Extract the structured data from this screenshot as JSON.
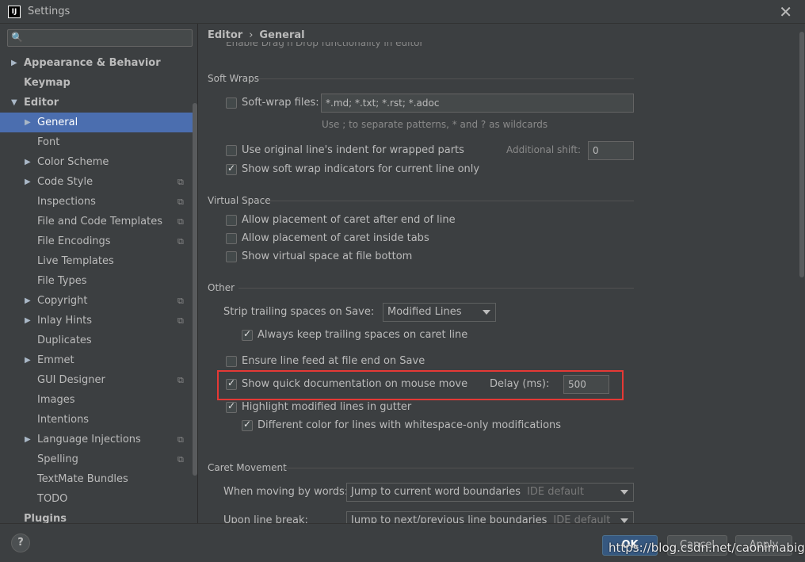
{
  "window": {
    "title": "Settings",
    "app_icon_text": "IJ",
    "close_glyph": "✕"
  },
  "search": {
    "placeholder": "",
    "icon_glyph": "🔍"
  },
  "tree": [
    {
      "label": "Appearance & Behavior",
      "bold": true,
      "arrow": "▶",
      "level": 0
    },
    {
      "label": "Keymap",
      "bold": true,
      "arrow": "",
      "level": 0
    },
    {
      "label": "Editor",
      "bold": true,
      "arrow": "▼",
      "level": 0
    },
    {
      "label": "General",
      "arrow": "▶",
      "level": 1,
      "selected": true
    },
    {
      "label": "Font",
      "arrow": "",
      "level": 1
    },
    {
      "label": "Color Scheme",
      "arrow": "▶",
      "level": 1
    },
    {
      "label": "Code Style",
      "arrow": "▶",
      "level": 1,
      "project": true
    },
    {
      "label": "Inspections",
      "arrow": "",
      "level": 1,
      "project": true
    },
    {
      "label": "File and Code Templates",
      "arrow": "",
      "level": 1,
      "project": true
    },
    {
      "label": "File Encodings",
      "arrow": "",
      "level": 1,
      "project": true
    },
    {
      "label": "Live Templates",
      "arrow": "",
      "level": 1
    },
    {
      "label": "File Types",
      "arrow": "",
      "level": 1
    },
    {
      "label": "Copyright",
      "arrow": "▶",
      "level": 1,
      "project": true
    },
    {
      "label": "Inlay Hints",
      "arrow": "▶",
      "level": 1,
      "project": true
    },
    {
      "label": "Duplicates",
      "arrow": "",
      "level": 1
    },
    {
      "label": "Emmet",
      "arrow": "▶",
      "level": 1
    },
    {
      "label": "GUI Designer",
      "arrow": "",
      "level": 1,
      "project": true
    },
    {
      "label": "Images",
      "arrow": "",
      "level": 1
    },
    {
      "label": "Intentions",
      "arrow": "",
      "level": 1
    },
    {
      "label": "Language Injections",
      "arrow": "▶",
      "level": 1,
      "project": true
    },
    {
      "label": "Spelling",
      "arrow": "",
      "level": 1,
      "project": true
    },
    {
      "label": "TextMate Bundles",
      "arrow": "",
      "level": 1
    },
    {
      "label": "TODO",
      "arrow": "",
      "level": 1
    },
    {
      "label": "Plugins",
      "bold": true,
      "arrow": "",
      "level": 0
    }
  ],
  "breadcrumb": {
    "parent": "Editor",
    "separator": "›",
    "current": "General"
  },
  "clipped_row": "Enable Drag'n'Drop functionality in editor",
  "soft_wraps": {
    "title": "Soft Wraps",
    "soft_wrap_files_label": "Soft-wrap files:",
    "soft_wrap_files_value": "*.md; *.txt; *.rst; *.adoc",
    "patterns_hint": "Use ; to separate patterns, * and ? as wildcards",
    "original_indent_label": "Use original line's indent for wrapped parts",
    "additional_shift_label": "Additional shift:",
    "additional_shift_value": "0",
    "show_indicators_label": "Show soft wrap indicators for current line only"
  },
  "virtual_space": {
    "title": "Virtual Space",
    "after_end_label": "Allow placement of caret after end of line",
    "inside_tabs_label": "Allow placement of caret inside tabs",
    "file_bottom_label": "Show virtual space at file bottom"
  },
  "other": {
    "title": "Other",
    "strip_label": "Strip trailing spaces on Save:",
    "strip_value": "Modified Lines",
    "keep_trailing_label": "Always keep trailing spaces on caret line",
    "line_feed_label": "Ensure line feed at file end on Save",
    "quick_doc_label": "Show quick documentation on mouse move",
    "delay_label": "Delay (ms):",
    "delay_value": "500",
    "highlight_modified_label": "Highlight modified lines in gutter",
    "different_color_label": "Different color for lines with whitespace-only modifications"
  },
  "caret_movement": {
    "title": "Caret Movement",
    "moving_words_label": "When moving by words:",
    "moving_words_value": "Jump to current word boundaries",
    "moving_words_hint": "IDE default",
    "line_break_label": "Upon line break:",
    "line_break_value": "Jump to next/previous line boundaries",
    "line_break_hint": "IDE default"
  },
  "buttons": {
    "help": "?",
    "ok": "OK",
    "cancel": "Cancel",
    "apply": "Apply"
  },
  "watermark": "https://blog.csdn.net/caonimabige",
  "colors": {
    "accent_selection": "#4b6eaf",
    "highlight_box": "#e53935",
    "ok_button": "#365880"
  }
}
